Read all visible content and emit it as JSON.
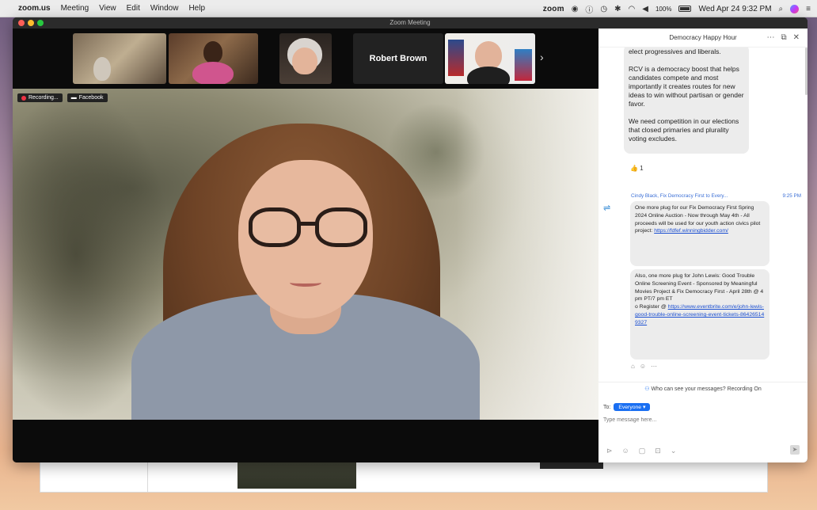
{
  "menubar": {
    "app_name": "zoom.us",
    "menus": [
      "Meeting",
      "View",
      "Edit",
      "Window",
      "Help"
    ],
    "status_word": "zoom",
    "battery": "100%",
    "clock": "Wed Apr 24  9:32 PM"
  },
  "window": {
    "title": "Zoom Meeting"
  },
  "gallery": {
    "name_tile": "Robert Brown",
    "next_glyph": "›"
  },
  "video": {
    "recording_label": "Recording...",
    "facebook_label": "Facebook"
  },
  "chat": {
    "header_title": "Democracy Happy Hour",
    "message_1": {
      "para_1": "elect progressives and liberals.",
      "para_2": "RCV is a democracy boost that helps candidates compete and most importantly it creates routes for new ideas to win without partisan or gender favor.",
      "para_3": "We need competition in our elections that closed primaries and plurality voting excludes."
    },
    "reaction": "👍 1",
    "sender": "Cindy Black, Fix Democracy First to Every...",
    "sender_time": "9:25 PM",
    "message_2": {
      "text": "One more plug for our Fix Democracy First Spring 2024 Online Auction - Now through May 4th - All proceeds will be used for our youth action civics pilot project:",
      "link": "https://fdfef.winningbidder.com/"
    },
    "message_3": {
      "text": "Also, one more plug for John Lewis: Good Trouble Online Screening Event - Sponsored by Meaningful Movies Project & Fix Democracy First - April 28th @ 4 pm PT/7 pm ET",
      "register_label": "o   Register @",
      "link": "https://www.eventbrite.com/e/john-lewis-good-trouble-online-screening-event-tickets-864265149327"
    },
    "privacy_notice": "Who can see your messages? Recording On",
    "to_label": "To:",
    "recipient": "Everyone ▾",
    "input_placeholder": "Type message here..."
  },
  "colors": {
    "accent_blue": "#1a6ff2",
    "link_blue": "#1b4fd1",
    "record_red": "#ee3344"
  }
}
